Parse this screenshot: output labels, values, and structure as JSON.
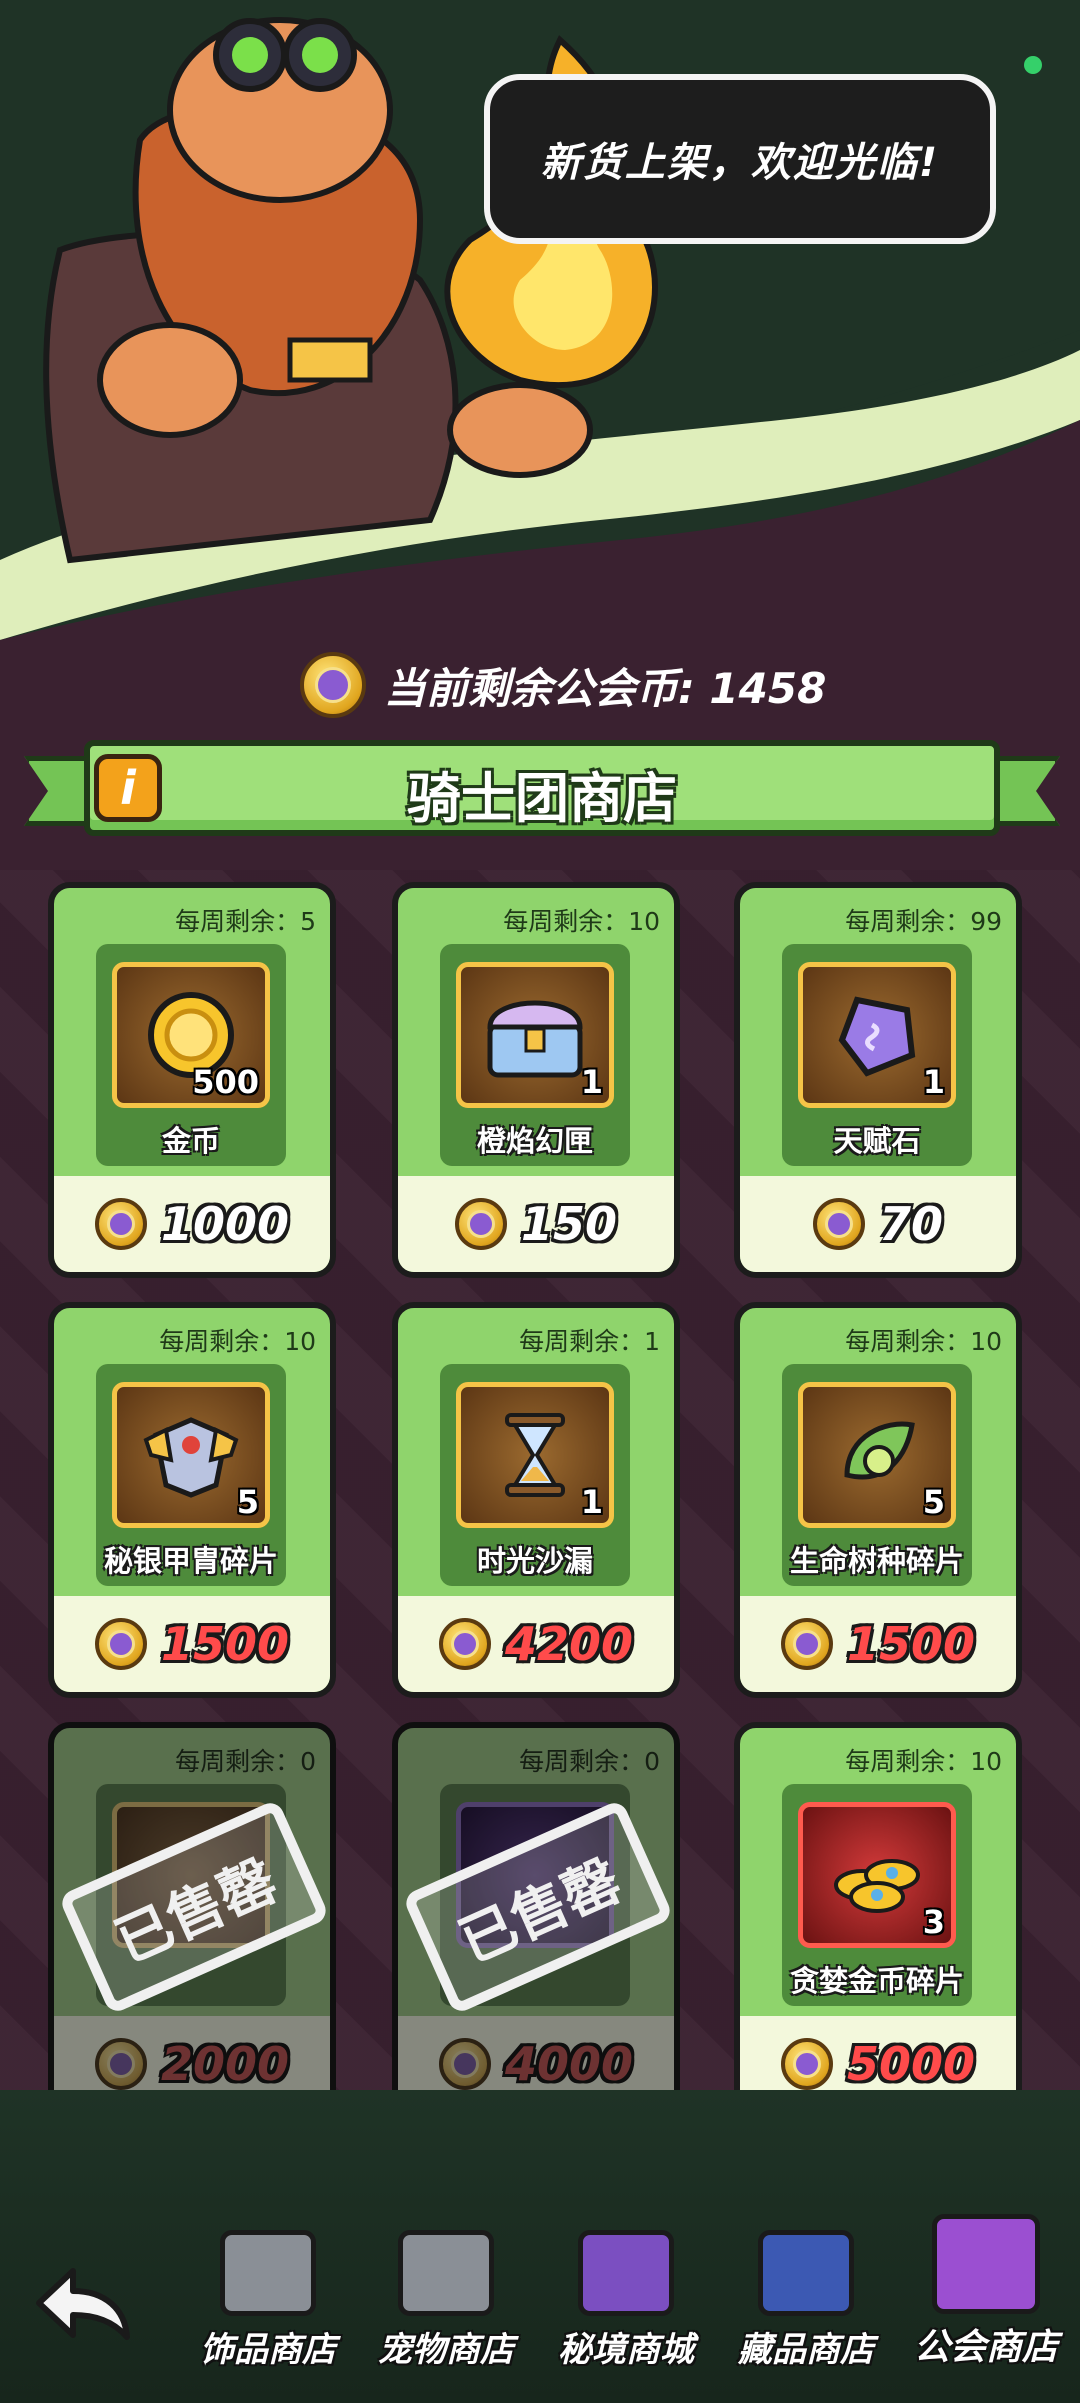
{
  "header": {
    "speech": "新货上架，欢迎光临!"
  },
  "currency": {
    "label": "当前剩余公会币: 1458",
    "amount": 1458
  },
  "shop": {
    "title": "骑士团商店",
    "info_icon": "i"
  },
  "items": [
    {
      "remain": "每周剩余：5",
      "qty": "500",
      "name": "金币",
      "price": "1000",
      "price_color": "white",
      "icon": "gold-coin-icon",
      "frame": "gold",
      "sold_out": false
    },
    {
      "remain": "每周剩余：10",
      "qty": "1",
      "name": "橙焰幻匣",
      "price": "150",
      "price_color": "white",
      "icon": "treasure-chest-icon",
      "frame": "gold",
      "sold_out": false
    },
    {
      "remain": "每周剩余：99",
      "qty": "1",
      "name": "天赋石",
      "price": "70",
      "price_color": "white",
      "icon": "purple-gem-icon",
      "frame": "gold",
      "sold_out": false
    },
    {
      "remain": "每周剩余：10",
      "qty": "5",
      "name": "秘银甲胄碎片",
      "price": "1500",
      "price_color": "red",
      "icon": "armor-fragment-icon",
      "frame": "gold",
      "sold_out": false
    },
    {
      "remain": "每周剩余：1",
      "qty": "1",
      "name": "时光沙漏",
      "price": "4200",
      "price_color": "red",
      "icon": "hourglass-icon",
      "frame": "gold",
      "sold_out": false
    },
    {
      "remain": "每周剩余：10",
      "qty": "5",
      "name": "生命树种碎片",
      "price": "1500",
      "price_color": "red",
      "icon": "leaf-seed-icon",
      "frame": "gold",
      "sold_out": false
    },
    {
      "remain": "每周剩余：0",
      "qty": "",
      "name": "",
      "price": "2000",
      "price_color": "red",
      "icon": "sold-item-icon",
      "frame": "gold",
      "sold_out": true,
      "stamp": "已售罄"
    },
    {
      "remain": "每周剩余：0",
      "qty": "",
      "name": "",
      "price": "4000",
      "price_color": "red",
      "icon": "sold-item-icon",
      "frame": "purple",
      "sold_out": true,
      "stamp": "已售罄"
    },
    {
      "remain": "每周剩余：10",
      "qty": "3",
      "name": "贪婪金币碎片",
      "price": "5000",
      "price_color": "red",
      "icon": "coin-pile-icon",
      "frame": "red",
      "sold_out": false
    }
  ],
  "nav": {
    "back": "back-arrow-icon",
    "tabs": [
      {
        "label": "饰品商店",
        "icon": "accessory-shop-icon",
        "color": "#8a8f96"
      },
      {
        "label": "宠物商店",
        "icon": "pet-shop-icon",
        "color": "#8a8f96"
      },
      {
        "label": "秘境商城",
        "icon": "secret-shop-icon",
        "color": "#7b4fc1"
      },
      {
        "label": "藏品商店",
        "icon": "collection-shop-icon",
        "color": "#3c59b3"
      },
      {
        "label": "公会商店",
        "icon": "guild-shop-icon",
        "color": "#9b4fd1",
        "active": true
      }
    ]
  },
  "colors": {
    "accent_green": "#8fd46c",
    "price_red": "#ff4b4b",
    "background": "#3a2130"
  }
}
